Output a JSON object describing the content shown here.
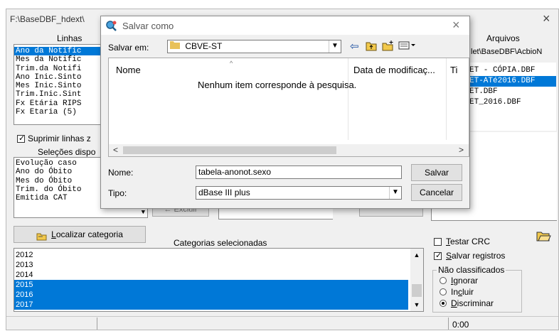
{
  "main": {
    "title": "F:\\BaseDBF_hdext\\",
    "close_glyph": "×",
    "linhas_label": "Linhas",
    "arquivos_label": "Arquivos",
    "arquivos_path": "let\\BaseDBF\\AcbioN",
    "linhas_items": [
      "Ano da Notific",
      "Mes da Notific",
      "Trim.da Notifi",
      "Ano Inic.Sinto",
      "Mes Inic.Sinto",
      "Trim.Inic.Sint",
      "Fx Etária RIPS",
      "Fx Etaria (5)"
    ],
    "arquivos_items": [
      "ET - CÓPIA.DBF",
      "ET-ATé2016.DBF",
      "ET.DBF",
      "ET_2016.DBF"
    ],
    "suprimir_label": "Suprimir linhas z",
    "selecoes_label": "Seleções dispo",
    "selecoes_items": [
      "Evolução caso",
      "Ano do Óbito",
      "Mes do Óbito",
      "Trim. do Óbito",
      "Emitida CAT"
    ],
    "partial_button_label": "Excluir",
    "localizar_prefix": "L",
    "localizar_rest": "ocalizar categoria",
    "categorias_label": "Categorias selecionadas",
    "categorias_items": [
      "2012",
      "2013",
      "2014",
      "2015",
      "2016",
      "2017"
    ],
    "testar_crc_prefix": "T",
    "testar_crc_rest": "estar CRC",
    "salvar_registros_prefix": "S",
    "salvar_registros_rest": "alvar registros",
    "nao_classificados_label": "Não classificados",
    "radio_ignorar_prefix": "I",
    "radio_ignorar_rest": "gnorar",
    "radio_incluir_prefix": "In",
    "radio_incluir_u": "c",
    "radio_incluir_rest": "luir",
    "radio_discriminar_prefix": "D",
    "radio_discriminar_rest": "iscriminar",
    "status_time": "0:00"
  },
  "dialog": {
    "title": "Salvar como",
    "close_glyph": "×",
    "salvar_em_label": "Salvar em:",
    "salvar_em_value": "CBVE-ST",
    "col_nome": "Nome",
    "col_data": "Data de modificaç...",
    "col_tipo": "Ti",
    "empty_message": "Nenhum item corresponde à pesquisa.",
    "nome_label": "Nome:",
    "nome_value": "tabela-anonot.sexo",
    "tipo_label": "Tipo:",
    "tipo_value": "dBase III plus",
    "salvar_button": "Salvar",
    "cancelar_button": "Cancelar"
  },
  "colors": {
    "selection": "#0078d7",
    "folder": "#e8c15a"
  },
  "icons": [
    "app-search-icon",
    "folder-icon",
    "back-arrow-icon",
    "up-folder-icon",
    "new-folder-icon",
    "view-menu-icon",
    "open-folder-icon",
    "find-category-icon"
  ]
}
